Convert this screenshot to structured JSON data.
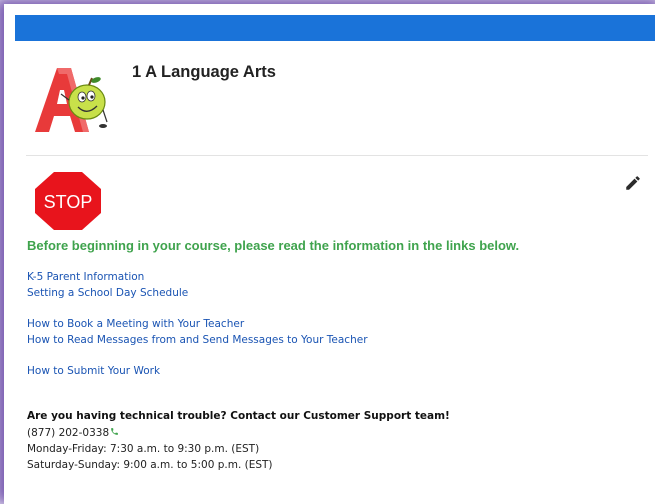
{
  "course": {
    "title": "1 A Language Arts"
  },
  "stop_sign": {
    "text": "STOP"
  },
  "intro": {
    "text": "Before beginning in your course, please read the information in the links below."
  },
  "links": {
    "parent_info": "K-5 Parent Information",
    "school_day": "Setting a School Day Schedule",
    "book_meeting": "How to Book a Meeting with Your Teacher",
    "messages": "How to Read Messages from and Send Messages to Your Teacher",
    "submit_work": "How to Submit Your Work"
  },
  "support": {
    "heading": "Are you having technical trouble? Contact our Customer Support team!",
    "phone": "(877) 202-0338",
    "hours_weekday": "Monday-Friday: 7:30 a.m. to 9:30 p.m. (EST)",
    "hours_weekend": "Saturday-Sunday: 9:00 a.m. to 5:00 p.m. (EST)"
  },
  "colors": {
    "topbar": "#1a73d9",
    "intro_green": "#3fa34d",
    "link_blue": "#1a54b3",
    "stop_red": "#e8141c"
  },
  "icons": {
    "edit": "pencil-icon",
    "phone": "phone-icon",
    "logo": "letter-a-apple-logo"
  }
}
